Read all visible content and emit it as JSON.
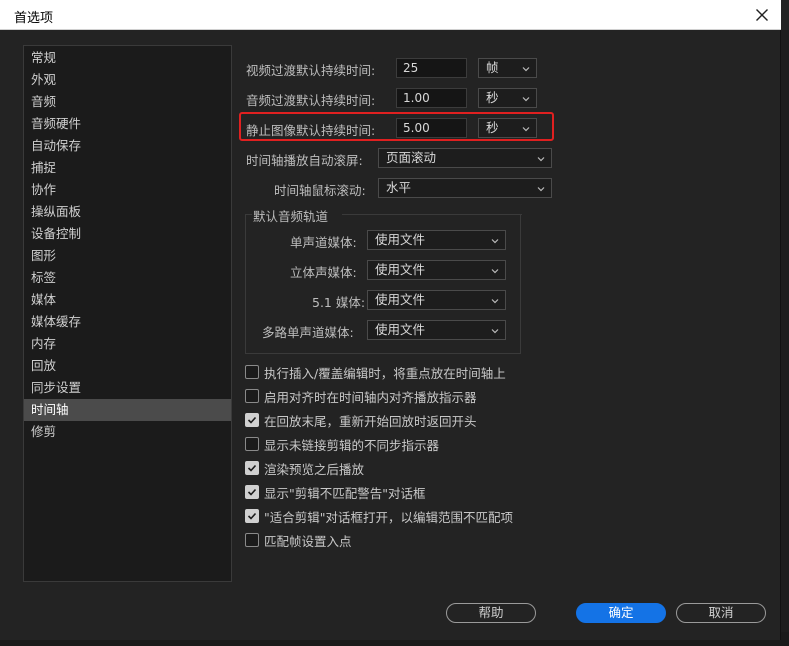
{
  "window": {
    "title": "首选项"
  },
  "sidebar": {
    "items": [
      {
        "label": "常规"
      },
      {
        "label": "外观"
      },
      {
        "label": "音频"
      },
      {
        "label": "音频硬件"
      },
      {
        "label": "自动保存"
      },
      {
        "label": "捕捉"
      },
      {
        "label": "协作"
      },
      {
        "label": "操纵面板"
      },
      {
        "label": "设备控制"
      },
      {
        "label": "图形"
      },
      {
        "label": "标签"
      },
      {
        "label": "媒体"
      },
      {
        "label": "媒体缓存"
      },
      {
        "label": "内存"
      },
      {
        "label": "回放"
      },
      {
        "label": "同步设置"
      },
      {
        "label": "时间轴"
      },
      {
        "label": "修剪"
      }
    ],
    "active_index": 16
  },
  "timeline": {
    "video_transition": {
      "label": "视频过渡默认持续时间:",
      "value": "25",
      "unit": "帧"
    },
    "audio_transition": {
      "label": "音频过渡默认持续时间:",
      "value": "1.00",
      "unit": "秒"
    },
    "still_image": {
      "label": "静止图像默认持续时间:",
      "value": "5.00",
      "unit": "秒"
    },
    "auto_scroll": {
      "label": "时间轴播放自动滚屏:",
      "value": "页面滚动"
    },
    "mouse_scroll": {
      "label": "时间轴鼠标滚动:",
      "value": "水平"
    },
    "default_audio_tracks": {
      "title": "默认音频轨道",
      "mono": {
        "label": "单声道媒体:",
        "value": "使用文件"
      },
      "stereo": {
        "label": "立体声媒体:",
        "value": "使用文件"
      },
      "surround": {
        "label": "5.1 媒体:",
        "value": "使用文件"
      },
      "multi_mono": {
        "label": "多路单声道媒体:",
        "value": "使用文件"
      }
    },
    "checkboxes": [
      {
        "label": "执行插入/覆盖编辑时，将重点放在时间轴上",
        "checked": false
      },
      {
        "label": "启用对齐时在时间轴内对齐播放指示器",
        "checked": false
      },
      {
        "label": "在回放末尾，重新开始回放时返回开头",
        "checked": true
      },
      {
        "label": "显示未链接剪辑的不同步指示器",
        "checked": false
      },
      {
        "label": "渲染预览之后播放",
        "checked": true
      },
      {
        "label": "显示\"剪辑不匹配警告\"对话框",
        "checked": true
      },
      {
        "label": "\"适合剪辑\"对话框打开，以编辑范围不匹配项",
        "checked": true
      },
      {
        "label": "匹配帧设置入点",
        "checked": false
      }
    ]
  },
  "footer": {
    "help": "帮助",
    "ok": "确定",
    "cancel": "取消"
  },
  "colors": {
    "accent": "#1473e6",
    "highlight": "#e02020",
    "panel": "#232323"
  }
}
